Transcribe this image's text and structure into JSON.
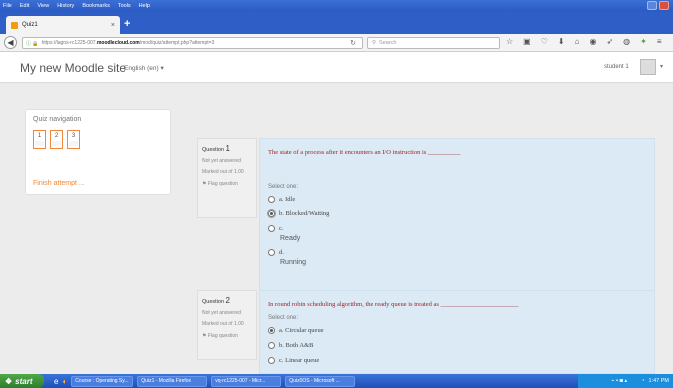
{
  "menubar": {
    "items": [
      "File",
      "Edit",
      "View",
      "History",
      "Bookmarks",
      "Tools",
      "Help"
    ]
  },
  "browser": {
    "tab_title": "Quiz1",
    "new_tab": "+",
    "url_prefix": "https://lagos-rc1225-007.",
    "url_host": "moodlecloud.com",
    "url_path": "/mod/quiz/attempt.php?attempt=3",
    "search_placeholder": "Search"
  },
  "header": {
    "site_name": "My new Moodle site",
    "language": "English (en) ▾",
    "user": "student 1"
  },
  "quiz_nav": {
    "title": "Quiz navigation",
    "buttons": [
      "1",
      "2",
      "3"
    ],
    "finish": "Finish attempt ..."
  },
  "questions": [
    {
      "label": "Question",
      "number": "1",
      "status": "Not yet answered",
      "marks": "Marked out of 1.00",
      "flag": "Flag question",
      "text": "The state of a process after it encounters an I/O instruction is __________",
      "select_one": "Select one:",
      "options": [
        {
          "letter": "a.",
          "text": "Idle"
        },
        {
          "letter": "b.",
          "text": "Blocked/Waiting"
        },
        {
          "letter": "c.",
          "text": "Ready"
        },
        {
          "letter": "d.",
          "text": "Running"
        }
      ]
    },
    {
      "label": "Question",
      "number": "2",
      "status": "Not yet answered",
      "marks": "Marked out of 1.00",
      "flag": "Flag question",
      "text": "In round robin scheduling algorithm, the ready queue is treated as ________________________",
      "select_one": "Select one:",
      "options": [
        {
          "letter": "a.",
          "text": "Circular queue"
        },
        {
          "letter": "b.",
          "text": "Both A&B"
        },
        {
          "letter": "c.",
          "text": "Linear queue"
        }
      ]
    }
  ],
  "taskbar": {
    "start": "start",
    "items": [
      "Course : Operating Sy...",
      "Quiz1 - Mozilla Firefox",
      "vq-rc1225-007 - Micr...",
      "Quiz0OS - Microsoft ..."
    ],
    "clock": "1:47 PM"
  }
}
